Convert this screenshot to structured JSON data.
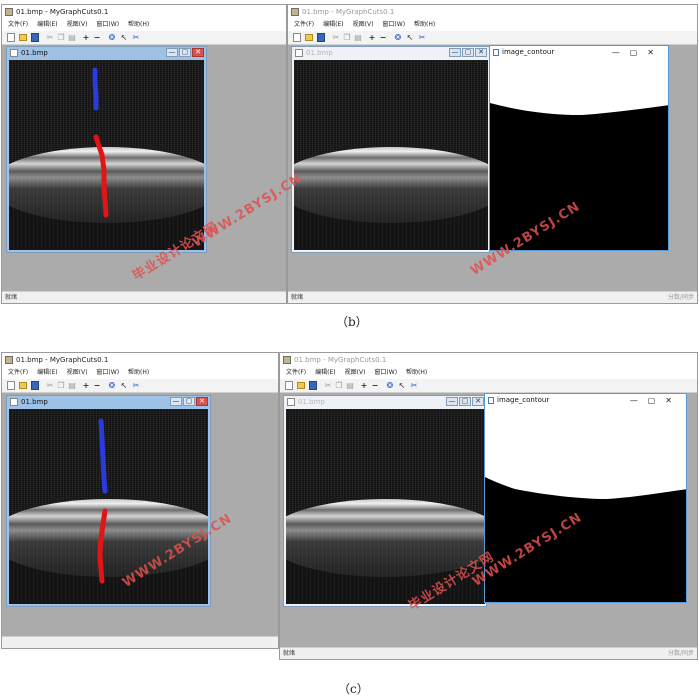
{
  "panel_b": {
    "caption": "（b）",
    "left_window": {
      "title": "01.bmp - MyGraphCuts0.1",
      "menu": [
        "文件(F)",
        "编辑(E)",
        "视图(V)",
        "窗口(W)",
        "帮助(H)"
      ],
      "child_title": "01.bmp",
      "status": "就绪"
    },
    "right_window": {
      "title": "01.bmp - MyGraphCuts0.1",
      "menu": [
        "文件(F)",
        "编辑(E)",
        "视图(V)",
        "窗口(W)",
        "帮助(H)"
      ],
      "child_title": "01.bmp",
      "contour_title": "image_contour",
      "status": "就绪",
      "status_right": "分数/同步"
    }
  },
  "panel_c": {
    "caption": "（c）",
    "left_window": {
      "title": "01.bmp - MyGraphCuts0.1",
      "menu": [
        "文件(F)",
        "编辑(E)",
        "视图(V)",
        "窗口(W)",
        "帮助(H)"
      ],
      "child_title": "01.bmp",
      "status": ""
    },
    "right_window": {
      "title": "01.bmp - MyGraphCuts0.1",
      "menu": [
        "文件(F)",
        "编辑(E)",
        "视图(V)",
        "窗口(W)",
        "帮助(H)"
      ],
      "child_title": "01.bmp",
      "contour_title": "image_contour",
      "status": "就绪",
      "status_right": "分数/同步"
    }
  },
  "toolbar_icons": [
    "new-file-icon",
    "open-folder-icon",
    "save-icon",
    "cut-icon",
    "copy-icon",
    "paste-icon",
    "plus-icon",
    "minus-icon",
    "help-icon",
    "pointer-icon",
    "scissors-icon"
  ],
  "window_buttons": {
    "minimize": "—",
    "restore": "▢",
    "close": "✕"
  },
  "watermark": {
    "url": "WWW.2BYSJ.CN",
    "cn": "毕业设计论文网"
  },
  "colors": {
    "foreground_stroke": "#2a3bdc",
    "background_stroke": "#e01515",
    "mdi_background": "#ababab",
    "watermark": "#e05050"
  }
}
